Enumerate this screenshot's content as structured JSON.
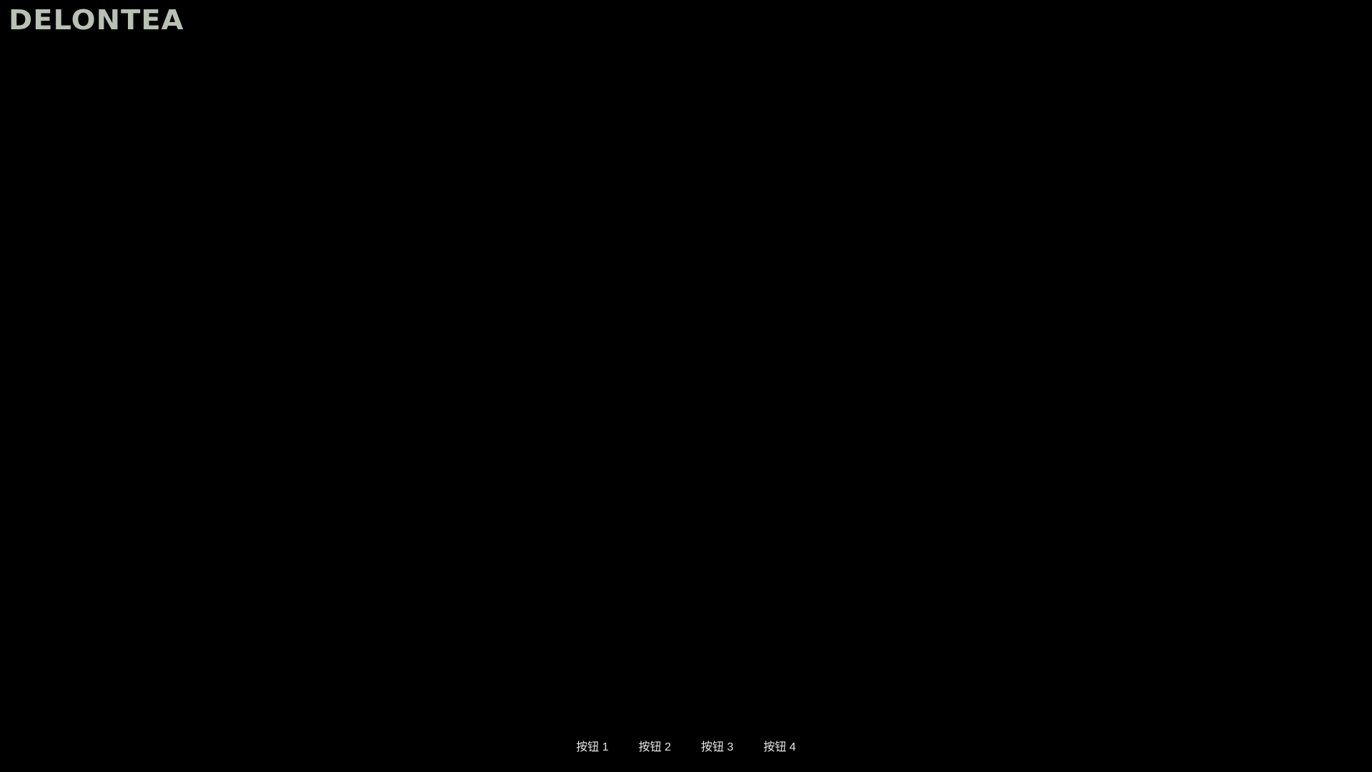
{
  "brand": {
    "logo_text": "DELONTEA",
    "logo_color": "#b9c0b4"
  },
  "background_color": "#000000",
  "nav": {
    "buttons": [
      {
        "label": "按钮 1"
      },
      {
        "label": "按钮 2"
      },
      {
        "label": "按钮 3"
      },
      {
        "label": "按钮 4"
      }
    ]
  }
}
